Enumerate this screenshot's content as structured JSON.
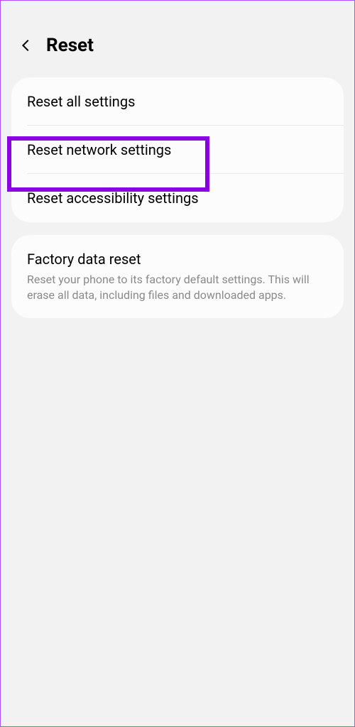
{
  "header": {
    "title": "Reset"
  },
  "group1": {
    "items": [
      {
        "title": "Reset all settings"
      },
      {
        "title": "Reset network settings"
      },
      {
        "title": "Reset accessibility settings"
      }
    ]
  },
  "group2": {
    "items": [
      {
        "title": "Factory data reset",
        "desc": "Reset your phone to its factory default settings. This will erase all data, including files and downloaded apps."
      }
    ]
  }
}
